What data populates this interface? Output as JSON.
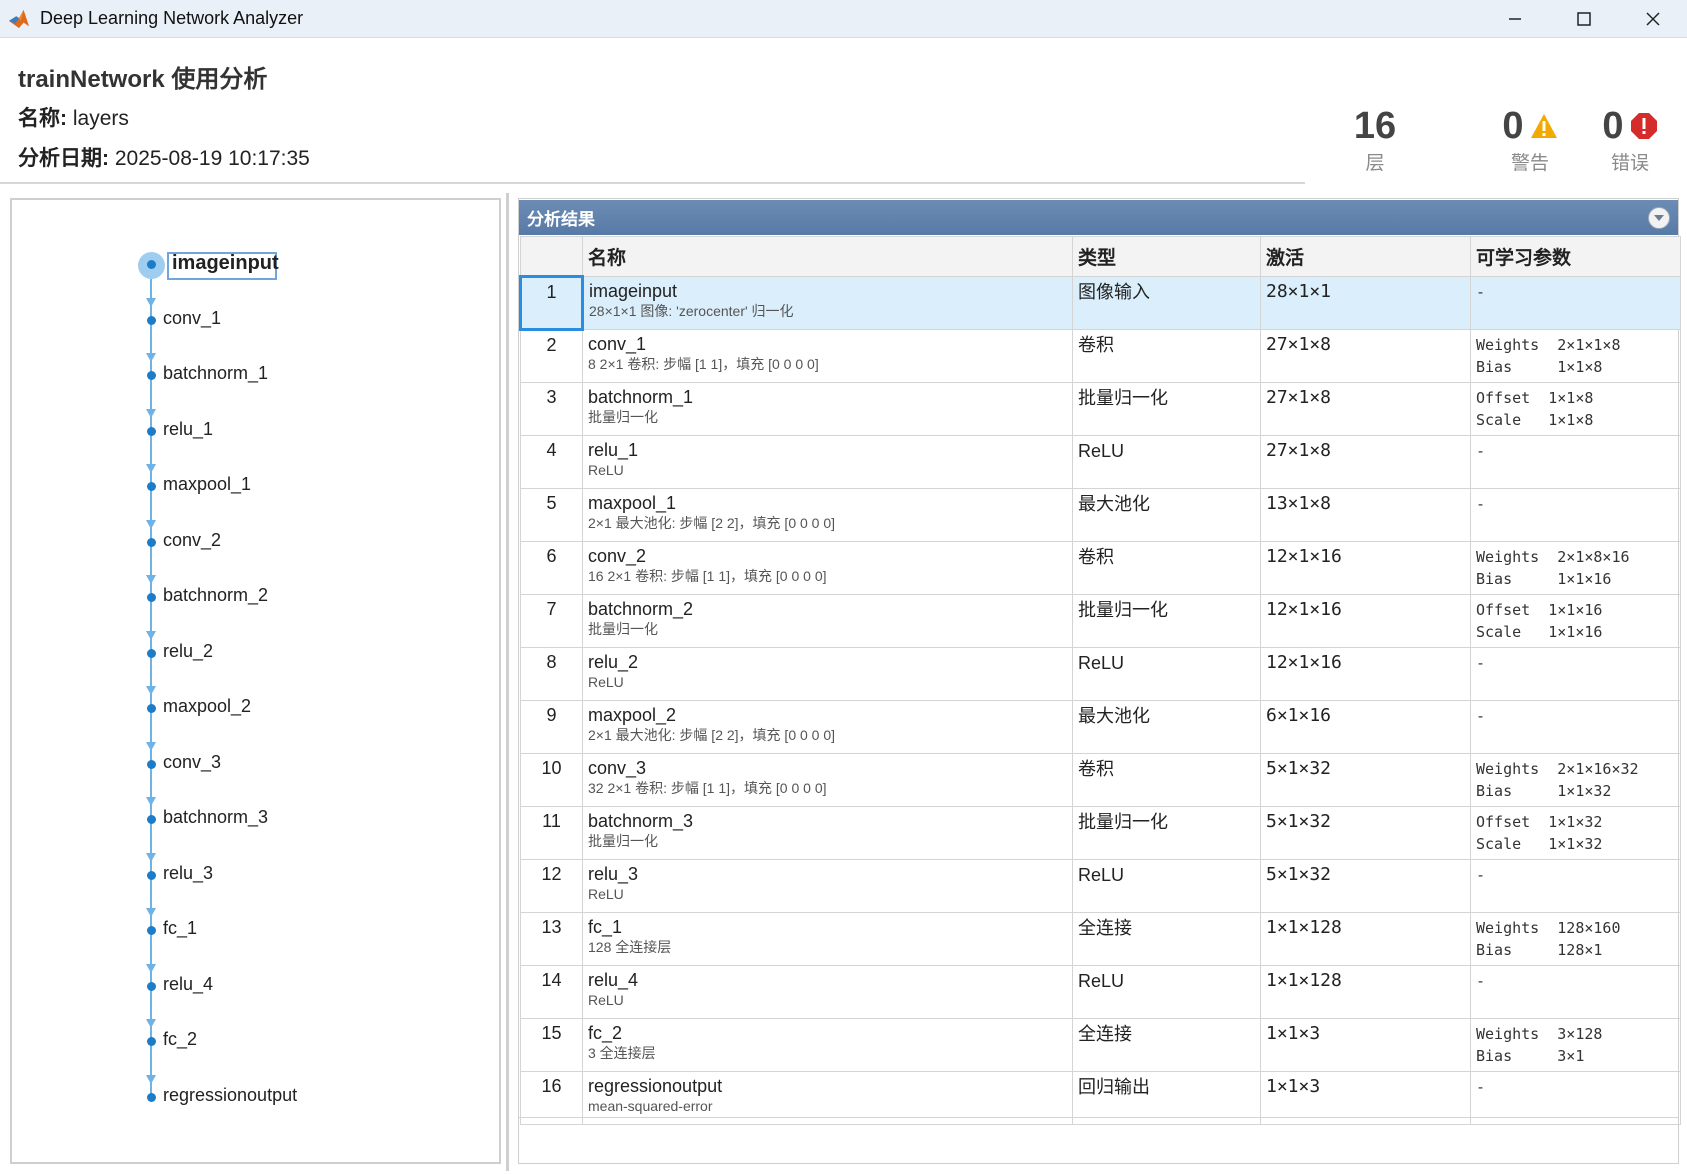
{
  "window": {
    "title": "Deep Learning Network Analyzer",
    "minimize_icon": "minimize-icon",
    "maximize_icon": "maximize-icon",
    "close_icon": "close-icon"
  },
  "header": {
    "title": "trainNetwork 使用分析",
    "name_key": "名称:",
    "name_value": "layers",
    "date_key": "分析日期:",
    "date_value": "2025-08-19 10:17:35"
  },
  "stats": {
    "layers": {
      "value": "16",
      "label": "层"
    },
    "warnings": {
      "value": "0",
      "label": "警告"
    },
    "errors": {
      "value": "0",
      "label": "错误"
    }
  },
  "graph": {
    "nodes": [
      "imageinput",
      "conv_1",
      "batchnorm_1",
      "relu_1",
      "maxpool_1",
      "conv_2",
      "batchnorm_2",
      "relu_2",
      "maxpool_2",
      "conv_3",
      "batchnorm_3",
      "relu_3",
      "fc_1",
      "relu_4",
      "fc_2",
      "regressionoutput"
    ],
    "selected": "imageinput"
  },
  "results": {
    "panel_title": "分析结果",
    "columns": [
      "",
      "名称",
      "类型",
      "激活",
      "可学习参数"
    ],
    "rows": [
      {
        "idx": "1",
        "name": "imageinput",
        "desc": "28×1×1 图像: 'zerocenter' 归一化",
        "type": "图像输入",
        "act": "28×1×1",
        "params": [
          "-"
        ]
      },
      {
        "idx": "2",
        "name": "conv_1",
        "desc": "8 2×1 卷积: 步幅 [1 1]，填充 [0 0 0 0]",
        "type": "卷积",
        "act": "27×1×8",
        "params": [
          "Weights  2×1×1×8",
          "Bias     1×1×8"
        ]
      },
      {
        "idx": "3",
        "name": "batchnorm_1",
        "desc": "批量归一化",
        "type": "批量归一化",
        "act": "27×1×8",
        "params": [
          "Offset  1×1×8",
          "Scale   1×1×8"
        ]
      },
      {
        "idx": "4",
        "name": "relu_1",
        "desc": "ReLU",
        "type": "ReLU",
        "act": "27×1×8",
        "params": [
          "-"
        ]
      },
      {
        "idx": "5",
        "name": "maxpool_1",
        "desc": "2×1 最大池化: 步幅 [2 2]，填充 [0 0 0 0]",
        "type": "最大池化",
        "act": "13×1×8",
        "params": [
          "-"
        ]
      },
      {
        "idx": "6",
        "name": "conv_2",
        "desc": "16 2×1 卷积: 步幅 [1 1]，填充 [0 0 0 0]",
        "type": "卷积",
        "act": "12×1×16",
        "params": [
          "Weights  2×1×8×16",
          "Bias     1×1×16"
        ]
      },
      {
        "idx": "7",
        "name": "batchnorm_2",
        "desc": "批量归一化",
        "type": "批量归一化",
        "act": "12×1×16",
        "params": [
          "Offset  1×1×16",
          "Scale   1×1×16"
        ]
      },
      {
        "idx": "8",
        "name": "relu_2",
        "desc": "ReLU",
        "type": "ReLU",
        "act": "12×1×16",
        "params": [
          "-"
        ]
      },
      {
        "idx": "9",
        "name": "maxpool_2",
        "desc": "2×1 最大池化: 步幅 [2 2]，填充 [0 0 0 0]",
        "type": "最大池化",
        "act": "6×1×16",
        "params": [
          "-"
        ]
      },
      {
        "idx": "10",
        "name": "conv_3",
        "desc": "32 2×1 卷积: 步幅 [1 1]，填充 [0 0 0 0]",
        "type": "卷积",
        "act": "5×1×32",
        "params": [
          "Weights  2×1×16×32",
          "Bias     1×1×32"
        ]
      },
      {
        "idx": "11",
        "name": "batchnorm_3",
        "desc": "批量归一化",
        "type": "批量归一化",
        "act": "5×1×32",
        "params": [
          "Offset  1×1×32",
          "Scale   1×1×32"
        ]
      },
      {
        "idx": "12",
        "name": "relu_3",
        "desc": "ReLU",
        "type": "ReLU",
        "act": "5×1×32",
        "params": [
          "-"
        ]
      },
      {
        "idx": "13",
        "name": "fc_1",
        "desc": "128 全连接层",
        "type": "全连接",
        "act": "1×1×128",
        "params": [
          "Weights  128×160",
          "Bias     128×1"
        ]
      },
      {
        "idx": "14",
        "name": "relu_4",
        "desc": "ReLU",
        "type": "ReLU",
        "act": "1×1×128",
        "params": [
          "-"
        ]
      },
      {
        "idx": "15",
        "name": "fc_2",
        "desc": "3 全连接层",
        "type": "全连接",
        "act": "1×1×3",
        "params": [
          "Weights  3×128",
          "Bias     3×1"
        ]
      },
      {
        "idx": "16",
        "name": "regressionoutput",
        "desc": "mean-squared-error",
        "type": "回归输出",
        "act": "1×1×3",
        "params": [
          "-"
        ]
      }
    ]
  },
  "colors": {
    "panel_header": "#5f80ab",
    "selection": "#dbeefc",
    "graph_line": "#6fb2e6",
    "node_dot": "#1d7cc7",
    "warning": "#f2a900",
    "error": "#d62b2b"
  }
}
